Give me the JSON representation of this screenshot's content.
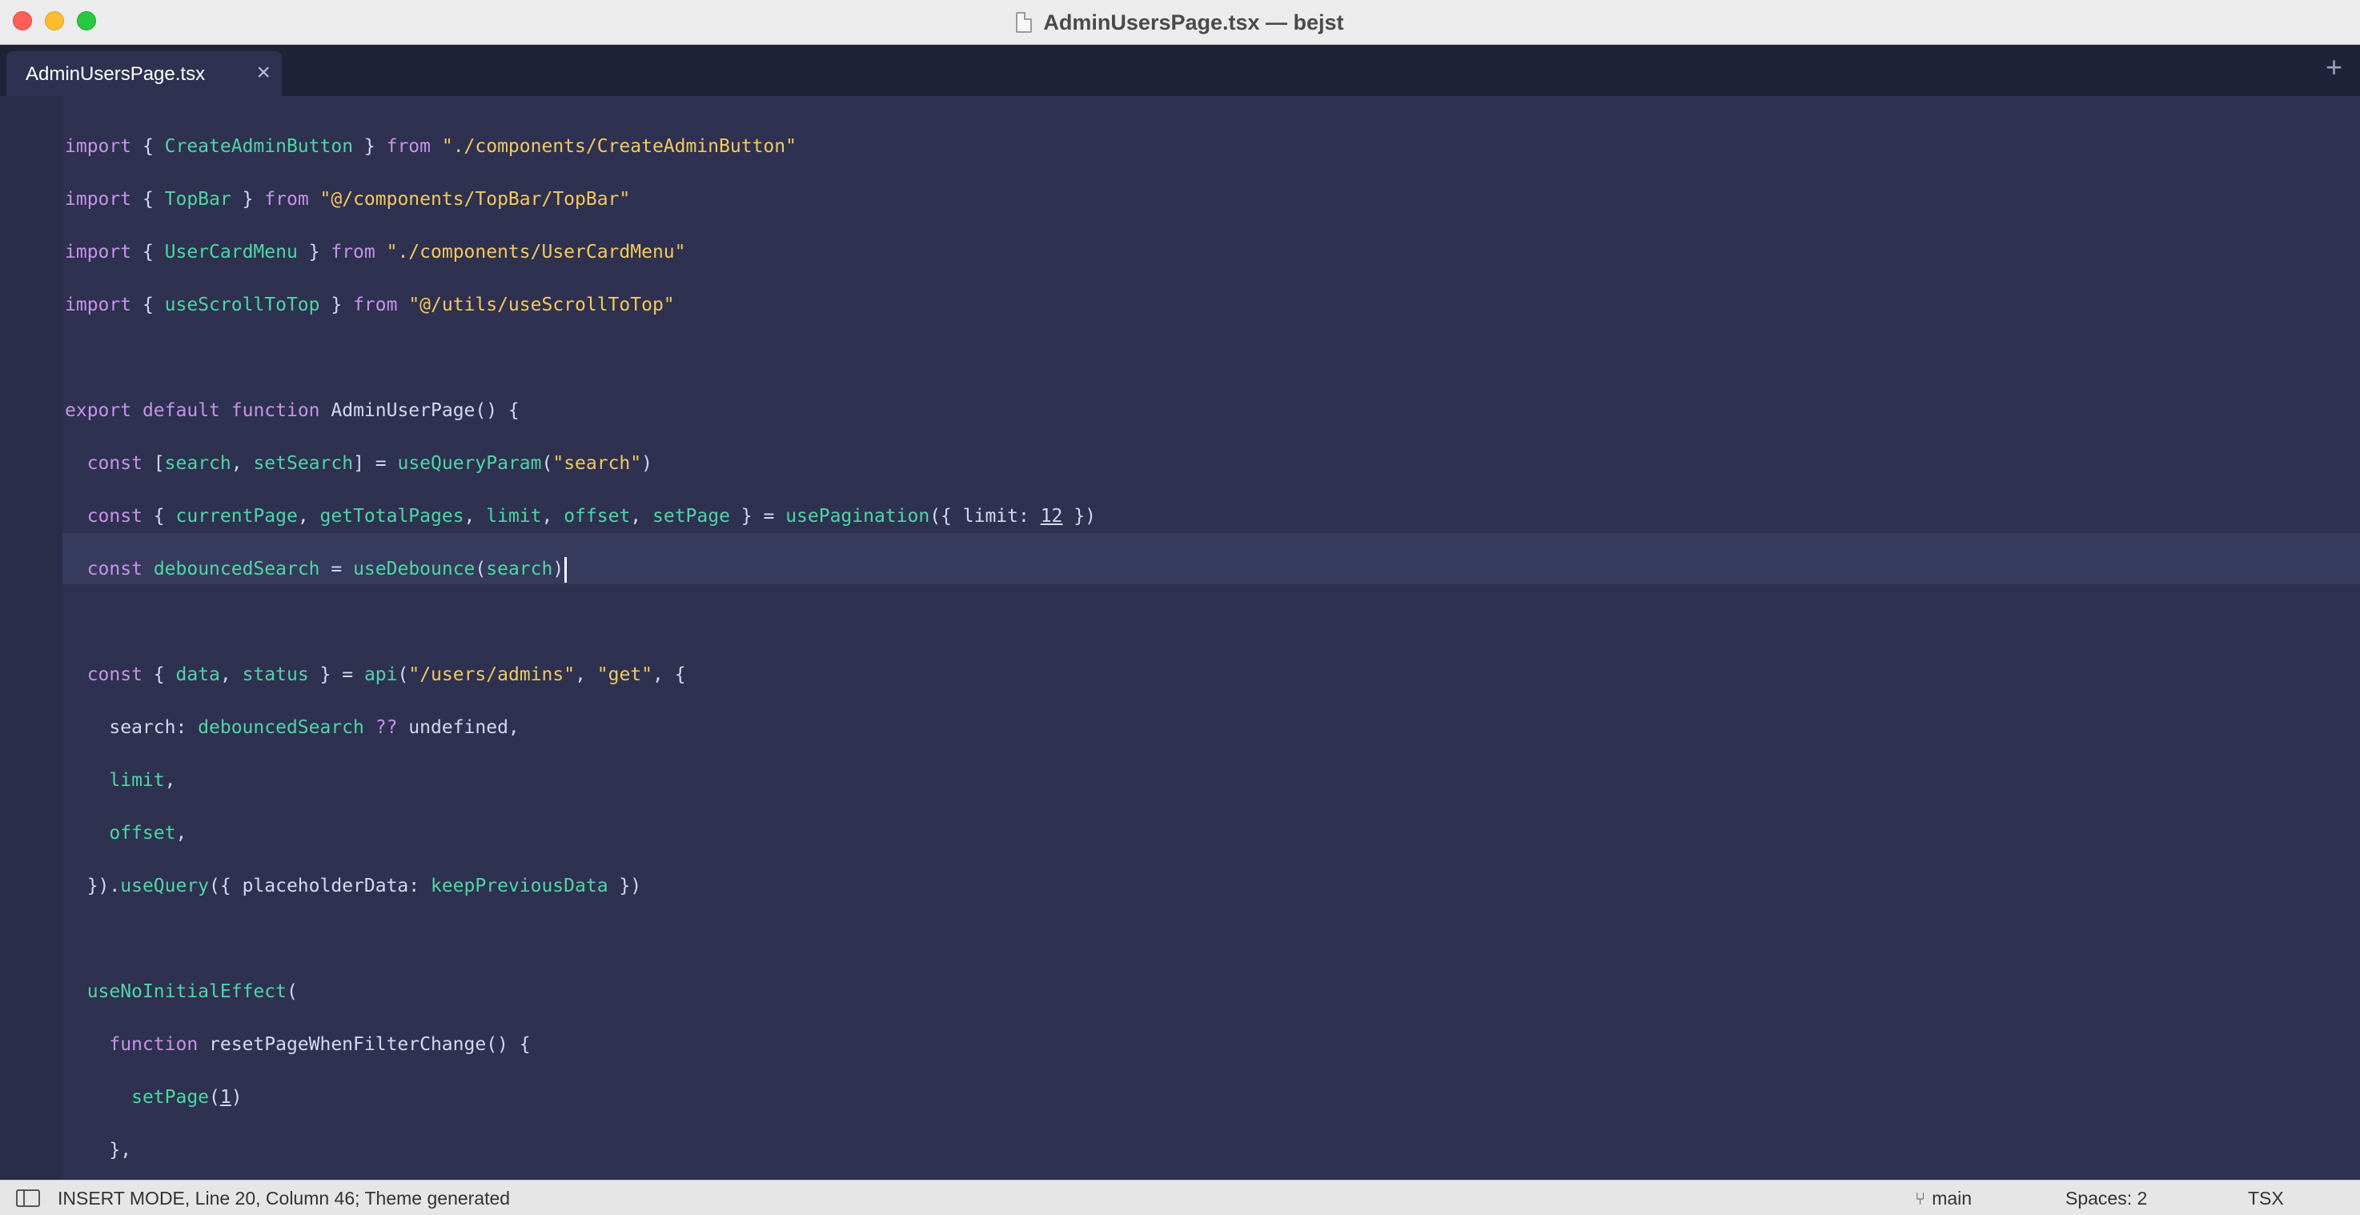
{
  "window": {
    "title": "AdminUsersPage.tsx — bejst"
  },
  "tabs": [
    {
      "label": "AdminUsersPage.tsx",
      "close": "×"
    }
  ],
  "new_tab_label": "+",
  "code_lines": [
    [
      [
        "kw",
        "import"
      ],
      [
        "p",
        " { "
      ],
      [
        "id",
        "CreateAdminButton"
      ],
      [
        "p",
        " } "
      ],
      [
        "kw",
        "from"
      ],
      [
        "p",
        " "
      ],
      [
        "str",
        "\"./components/CreateAdminButton\""
      ]
    ],
    [
      [
        "kw",
        "import"
      ],
      [
        "p",
        " { "
      ],
      [
        "id",
        "TopBar"
      ],
      [
        "p",
        " } "
      ],
      [
        "kw",
        "from"
      ],
      [
        "p",
        " "
      ],
      [
        "str",
        "\"@/components/TopBar/TopBar\""
      ]
    ],
    [
      [
        "kw",
        "import"
      ],
      [
        "p",
        " { "
      ],
      [
        "id",
        "UserCardMenu"
      ],
      [
        "p",
        " } "
      ],
      [
        "kw",
        "from"
      ],
      [
        "p",
        " "
      ],
      [
        "str",
        "\"./components/UserCardMenu\""
      ]
    ],
    [
      [
        "kw",
        "import"
      ],
      [
        "p",
        " { "
      ],
      [
        "id",
        "useScrollToTop"
      ],
      [
        "p",
        " } "
      ],
      [
        "kw",
        "from"
      ],
      [
        "p",
        " "
      ],
      [
        "str",
        "\"@/utils/useScrollToTop\""
      ]
    ],
    [],
    [
      [
        "kw",
        "export"
      ],
      [
        "p",
        " "
      ],
      [
        "kw",
        "default"
      ],
      [
        "p",
        " "
      ],
      [
        "kw",
        "function"
      ],
      [
        "p",
        " AdminUserPage() {"
      ]
    ],
    [
      [
        "p",
        "  "
      ],
      [
        "kw",
        "const"
      ],
      [
        "p",
        " ["
      ],
      [
        "id",
        "search"
      ],
      [
        "p",
        ", "
      ],
      [
        "id",
        "setSearch"
      ],
      [
        "p",
        "] = "
      ],
      [
        "id",
        "useQueryParam"
      ],
      [
        "p",
        "("
      ],
      [
        "str",
        "\"search\""
      ],
      [
        "p",
        ")"
      ]
    ],
    [
      [
        "p",
        "  "
      ],
      [
        "kw",
        "const"
      ],
      [
        "p",
        " { "
      ],
      [
        "id",
        "currentPage"
      ],
      [
        "p",
        ", "
      ],
      [
        "id",
        "getTotalPages"
      ],
      [
        "p",
        ", "
      ],
      [
        "id",
        "limit"
      ],
      [
        "p",
        ", "
      ],
      [
        "id",
        "offset"
      ],
      [
        "p",
        ", "
      ],
      [
        "id",
        "setPage"
      ],
      [
        "p",
        " } = "
      ],
      [
        "id",
        "usePagination"
      ],
      [
        "p",
        "({ limit: "
      ],
      [
        "num",
        "12"
      ],
      [
        "p",
        " })"
      ]
    ],
    [
      [
        "p",
        "  "
      ],
      [
        "kw",
        "const"
      ],
      [
        "p",
        " "
      ],
      [
        "id",
        "debouncedSearch"
      ],
      [
        "p",
        " = "
      ],
      [
        "id",
        "useDebounce"
      ],
      [
        "p",
        "("
      ],
      [
        "id",
        "search"
      ],
      [
        "p",
        ")"
      ],
      [
        "caret",
        ""
      ]
    ],
    [],
    [
      [
        "p",
        "  "
      ],
      [
        "kw",
        "const"
      ],
      [
        "p",
        " { "
      ],
      [
        "id",
        "data"
      ],
      [
        "p",
        ", "
      ],
      [
        "id",
        "status"
      ],
      [
        "p",
        " } = "
      ],
      [
        "id",
        "api"
      ],
      [
        "p",
        "("
      ],
      [
        "str",
        "\"/users/admins\""
      ],
      [
        "p",
        ", "
      ],
      [
        "str",
        "\"get\""
      ],
      [
        "p",
        ", {"
      ]
    ],
    [
      [
        "p",
        "    search: "
      ],
      [
        "id",
        "debouncedSearch"
      ],
      [
        "p",
        " "
      ],
      [
        "op",
        "??"
      ],
      [
        "p",
        " undefined,"
      ]
    ],
    [
      [
        "p",
        "    "
      ],
      [
        "id",
        "limit"
      ],
      [
        "p",
        ","
      ]
    ],
    [
      [
        "p",
        "    "
      ],
      [
        "id",
        "offset"
      ],
      [
        "p",
        ","
      ]
    ],
    [
      [
        "p",
        "  })."
      ],
      [
        "id",
        "useQuery"
      ],
      [
        "p",
        "({ placeholderData: "
      ],
      [
        "id",
        "keepPreviousData"
      ],
      [
        "p",
        " })"
      ]
    ],
    [],
    [
      [
        "p",
        "  "
      ],
      [
        "id",
        "useNoInitialEffect"
      ],
      [
        "p",
        "("
      ]
    ],
    [
      [
        "p",
        "    "
      ],
      [
        "kw",
        "function"
      ],
      [
        "p",
        " resetPageWhenFilterChange() {"
      ]
    ],
    [
      [
        "p",
        "      "
      ],
      [
        "id",
        "setPage"
      ],
      [
        "p",
        "("
      ],
      [
        "num",
        "1"
      ],
      [
        "p",
        ")"
      ]
    ],
    [
      [
        "p",
        "    },"
      ]
    ]
  ],
  "statusbar": {
    "text": "INSERT MODE, Line 20, Column 46; Theme generated",
    "branch": "main",
    "spaces": "Spaces: 2",
    "syntax": "TSX"
  },
  "icons": {
    "file": "file-icon",
    "sidebar": "sidebar-toggle-icon",
    "branch": "git-branch-icon"
  }
}
